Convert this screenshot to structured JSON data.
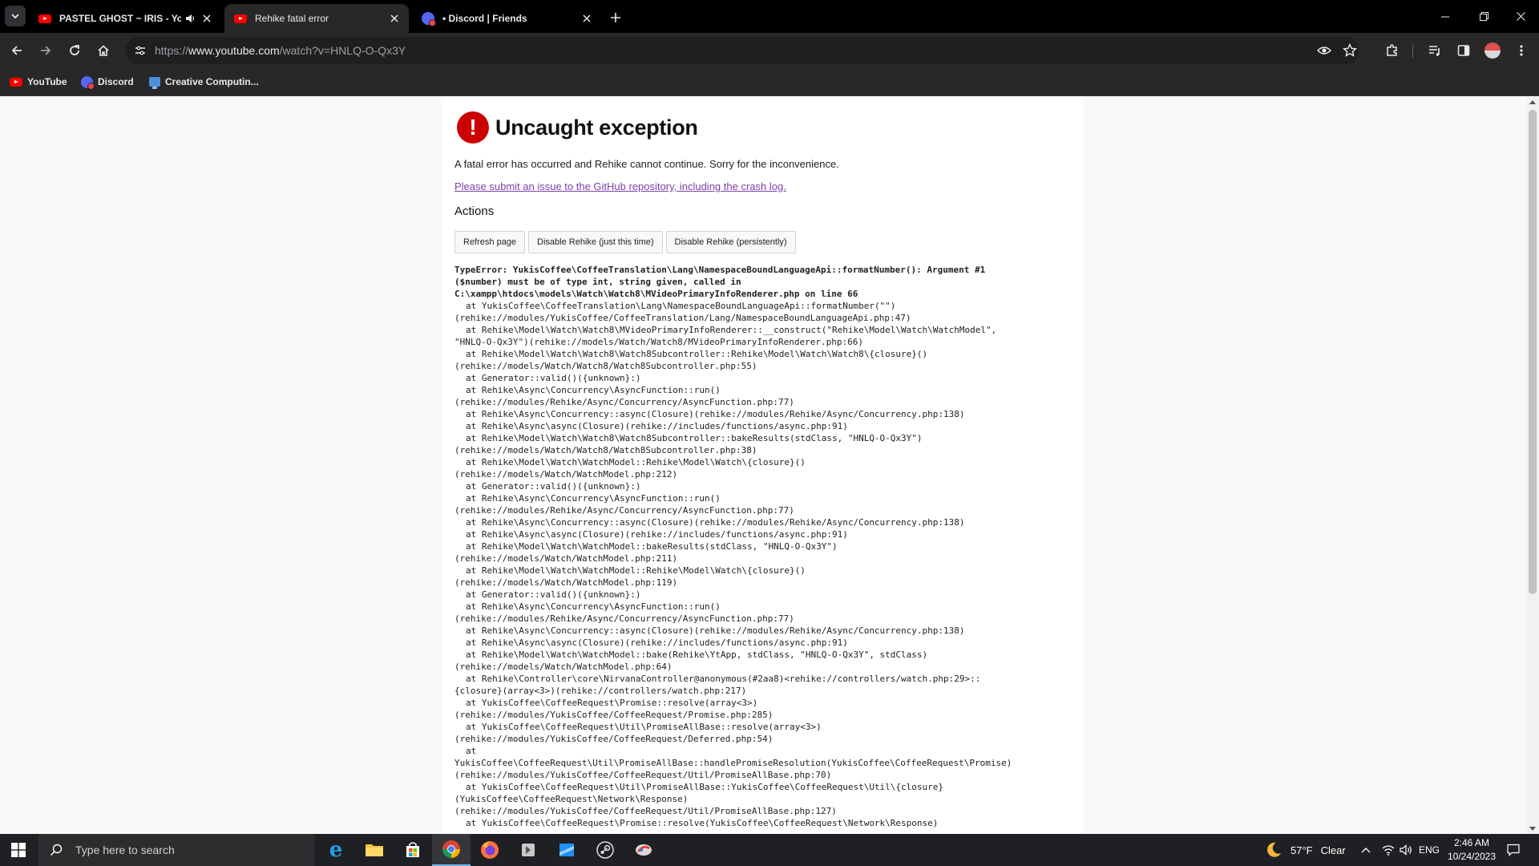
{
  "browser": {
    "tabs": [
      {
        "title": "PASTEL GHOST ~ IRIS - YouTube",
        "favicon": "youtube-icon",
        "audio": true
      },
      {
        "title": "Rehike fatal error",
        "favicon": "youtube-icon",
        "active": true
      },
      {
        "title": "• Discord | Friends",
        "favicon": "discord-icon"
      }
    ],
    "url": {
      "scheme": "https://",
      "host": "www.youtube.com",
      "path": "/watch?v=HNLQ-O-Qx3Y"
    },
    "bookmarks": [
      {
        "label": "YouTube"
      },
      {
        "label": "Discord"
      },
      {
        "label": "Creative Computin..."
      }
    ]
  },
  "error": {
    "title": "Uncaught exception",
    "description": "A fatal error has occurred and Rehike cannot continue. Sorry for the inconvenience.",
    "link": "Please submit an issue to the GitHub repository, including the crash log.",
    "actions_heading": "Actions",
    "buttons": [
      "Refresh page",
      "Disable Rehike (just this time)",
      "Disable Rehike (persistently)"
    ],
    "trace": [
      "TypeError: YukisCoffee\\CoffeeTranslation\\Lang\\NamespaceBoundLanguageApi::formatNumber(): Argument #1",
      "($number) must be of type int, string given, called in",
      "C:\\xampp\\htdocs\\models\\Watch\\Watch8\\MVideoPrimaryInfoRenderer.php on line 66",
      "at YukisCoffee\\CoffeeTranslation\\Lang\\NamespaceBoundLanguageApi::formatNumber(\"\")",
      "(rehike://modules/YukisCoffee/CoffeeTranslation/Lang/NamespaceBoundLanguageApi.php:47)",
      "at Rehike\\Model\\Watch\\Watch8\\MVideoPrimaryInfoRenderer::__construct(\"Rehike\\Model\\Watch\\WatchModel\",",
      "\"HNLQ-O-Qx3Y\")(rehike://models/Watch/Watch8/MVideoPrimaryInfoRenderer.php:66)",
      "at Rehike\\Model\\Watch\\Watch8\\Watch8Subcontroller::Rehike\\Model\\Watch\\Watch8\\{closure}()",
      "(rehike://models/Watch/Watch8/Watch8Subcontroller.php:55)",
      "at Generator::valid()({unknown}:)",
      "at Rehike\\Async\\Concurrency\\AsyncFunction::run()",
      "(rehike://modules/Rehike/Async/Concurrency/AsyncFunction.php:77)",
      "at Rehike\\Async\\Concurrency::async(Closure)(rehike://modules/Rehike/Async/Concurrency.php:138)",
      "at Rehike\\Async\\async(Closure)(rehike://includes/functions/async.php:91)",
      "at Rehike\\Model\\Watch\\Watch8\\Watch8Subcontroller::bakeResults(stdClass, \"HNLQ-O-Qx3Y\")",
      "(rehike://models/Watch/Watch8/Watch8Subcontroller.php:38)",
      "at Rehike\\Model\\Watch\\WatchModel::Rehike\\Model\\Watch\\{closure}()",
      "(rehike://models/Watch/WatchModel.php:212)",
      "at Generator::valid()({unknown}:)",
      "at Rehike\\Async\\Concurrency\\AsyncFunction::run()",
      "(rehike://modules/Rehike/Async/Concurrency/AsyncFunction.php:77)",
      "at Rehike\\Async\\Concurrency::async(Closure)(rehike://modules/Rehike/Async/Concurrency.php:138)",
      "at Rehike\\Async\\async(Closure)(rehike://includes/functions/async.php:91)",
      "at Rehike\\Model\\Watch\\WatchModel::bakeResults(stdClass, \"HNLQ-O-Qx3Y\")",
      "(rehike://models/Watch/WatchModel.php:211)",
      "at Rehike\\Model\\Watch\\WatchModel::Rehike\\Model\\Watch\\{closure}()",
      "(rehike://models/Watch/WatchModel.php:119)",
      "at Generator::valid()({unknown}:)",
      "at Rehike\\Async\\Concurrency\\AsyncFunction::run()",
      "(rehike://modules/Rehike/Async/Concurrency/AsyncFunction.php:77)",
      "at Rehike\\Async\\Concurrency::async(Closure)(rehike://modules/Rehike/Async/Concurrency.php:138)",
      "at Rehike\\Async\\async(Closure)(rehike://includes/functions/async.php:91)",
      "at Rehike\\Model\\Watch\\WatchModel::bake(Rehike\\YtApp, stdClass, \"HNLQ-O-Qx3Y\", stdClass)",
      "(rehike://models/Watch/WatchModel.php:64)",
      "at Rehike\\Controller\\core\\NirvanaController@anonymous(#2aa8)<rehike://controllers/watch.php:29>::",
      "{closure}(array<3>)(rehike://controllers/watch.php:217)",
      "at YukisCoffee\\CoffeeRequest\\Promise::resolve(array<3>)",
      "(rehike://modules/YukisCoffee/CoffeeRequest/Promise.php:285)",
      "at YukisCoffee\\CoffeeRequest\\Util\\PromiseAllBase::resolve(array<3>)",
      "(rehike://modules/YukisCoffee/CoffeeRequest/Deferred.php:54)",
      "at",
      "YukisCoffee\\CoffeeRequest\\Util\\PromiseAllBase::handlePromiseResolution(YukisCoffee\\CoffeeRequest\\Promise)",
      "(rehike://modules/YukisCoffee/CoffeeRequest/Util/PromiseAllBase.php:70)",
      "at YukisCoffee\\CoffeeRequest\\Util\\PromiseAllBase::YukisCoffee\\CoffeeRequest\\Util\\{closure}",
      "(YukisCoffee\\CoffeeRequest\\Network\\Response)",
      "(rehike://modules/YukisCoffee/CoffeeRequest/Util/PromiseAllBase.php:127)",
      "at YukisCoffee\\CoffeeRequest\\Promise::resolve(YukisCoffee\\CoffeeRequest\\Network\\Response)"
    ]
  },
  "taskbar": {
    "search_placeholder": "Type here to search",
    "apps": [
      "internet-explorer-icon",
      "file-explorer-icon",
      "store-icon",
      "chrome-icon",
      "firefox-icon",
      "app-icon",
      "app-icon",
      "steam-icon",
      "app-icon"
    ],
    "weather": {
      "temp": "57°F",
      "condition": "Clear"
    },
    "language": "ENG",
    "time": "2:46 AM",
    "date": "10/24/2023"
  },
  "colors": {
    "accent_error": "#cc0000",
    "link": "#7b3fa8",
    "function": "#a0125c"
  }
}
